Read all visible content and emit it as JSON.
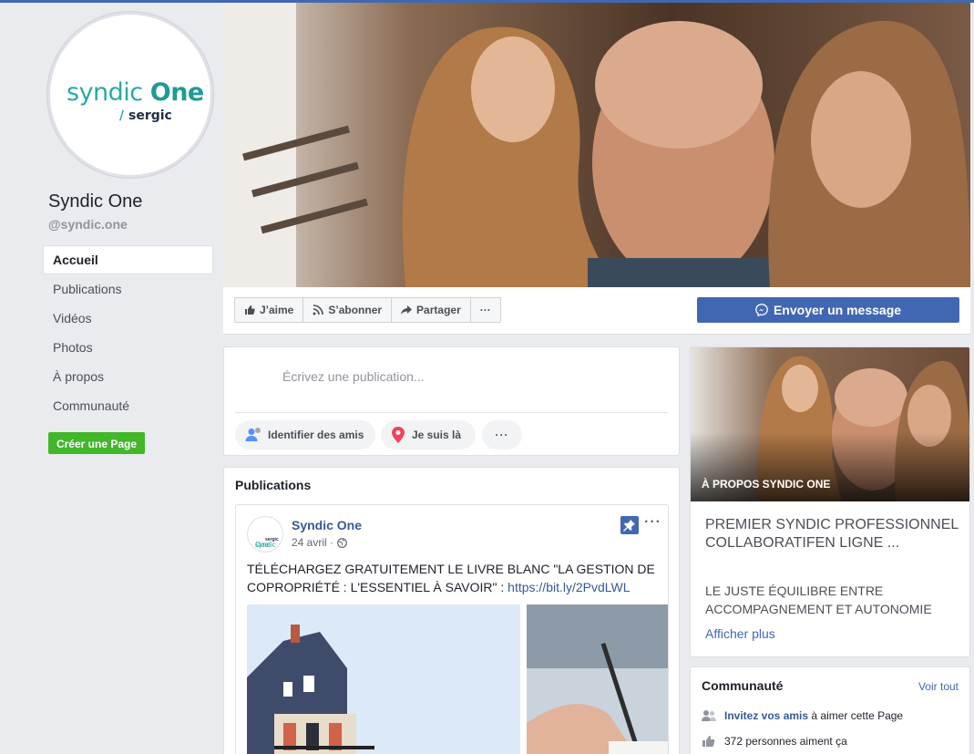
{
  "page": {
    "name": "Syndic One",
    "handle": "@syndic.one",
    "logo_text_1": "syndic",
    "logo_text_2": "One",
    "logo_sub": "sergic"
  },
  "nav": {
    "items": [
      {
        "label": "Accueil"
      },
      {
        "label": "Publications"
      },
      {
        "label": "Vidéos"
      },
      {
        "label": "Photos"
      },
      {
        "label": "À propos"
      },
      {
        "label": "Communauté"
      }
    ],
    "create_page": "Créer une Page"
  },
  "actions": {
    "like": "J’aime",
    "follow": "S’abonner",
    "share": "Partager",
    "more": "···",
    "message": "Envoyer un message"
  },
  "composer": {
    "placeholder": "Écrivez une publication...",
    "tag_friends": "Identifier des amis",
    "checkin": "Je suis là",
    "more": "···"
  },
  "publications": {
    "header": "Publications",
    "post": {
      "author": "Syndic One",
      "date": "24 avril ·",
      "text": "TÉLÉCHARGEZ GRATUITEMENT LE LIVRE BLANC \"LA GESTION DE COPROPRIÉTÉ : L'ESSENTIEL À SAVOIR\" : ",
      "link": "https://bit.ly/2PvdLWL",
      "menu": "···"
    }
  },
  "about": {
    "title": "À PROPOS SYNDIC ONE",
    "tagline": "PREMIER SYNDIC PROFESSIONNEL COLLABORATIFEN LIGNE ...",
    "description": "LE JUSTE ÉQUILIBRE ENTRE ACCOMPAGNEMENT ET AUTONOMIE",
    "more": "Afficher plus"
  },
  "community": {
    "title": "Communauté",
    "see_all": "Voir tout",
    "invite_link": "Invitez vos amis",
    "invite_rest": " à aimer cette Page",
    "likes": "372 personnes aiment ça"
  },
  "colors": {
    "brand": "#4267b2",
    "teal": "#2aa9a5",
    "green": "#42b72a"
  }
}
